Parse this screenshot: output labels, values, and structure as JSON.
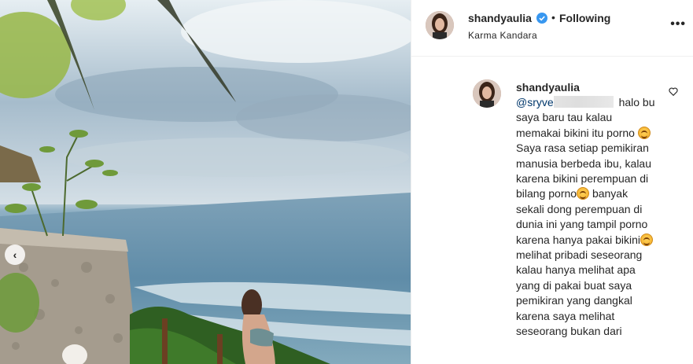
{
  "post": {
    "image_alt": "Photo: woman in bikini on a cliffside overlooking the ocean",
    "carousel_prev_icon": "chevron-left-icon"
  },
  "header": {
    "username": "shandyaulia",
    "verified_icon": "verified-badge-icon",
    "separator": "•",
    "follow_status": "Following",
    "location": "Karma Kandara",
    "more_icon": "more-horizontal-icon"
  },
  "comment": {
    "username": "shandyaulia",
    "mention": "@sryve",
    "lines": [
      "halo bu saya baru tau kalau memakai bikini itu porno",
      "Saya rasa setiap pemikiran manusia berbeda ibu, kalau karena bikini perempuan di bilang porno",
      "banyak sekali dong perempuan di dunia ini yang tampil porno karena hanya pakai bikini",
      "melihat pribadi seseorang kalau hanya melihat apa yang di pakai buat saya pemikiran yang dangkal karena saya melihat seseorang bukan dari"
    ],
    "like_icon": "heart-icon",
    "emoji_icon": "smiling-face-emoji"
  },
  "colors": {
    "text": "#262626",
    "link": "#00376b",
    "verified": "#3897f0",
    "border": "#efefef"
  }
}
